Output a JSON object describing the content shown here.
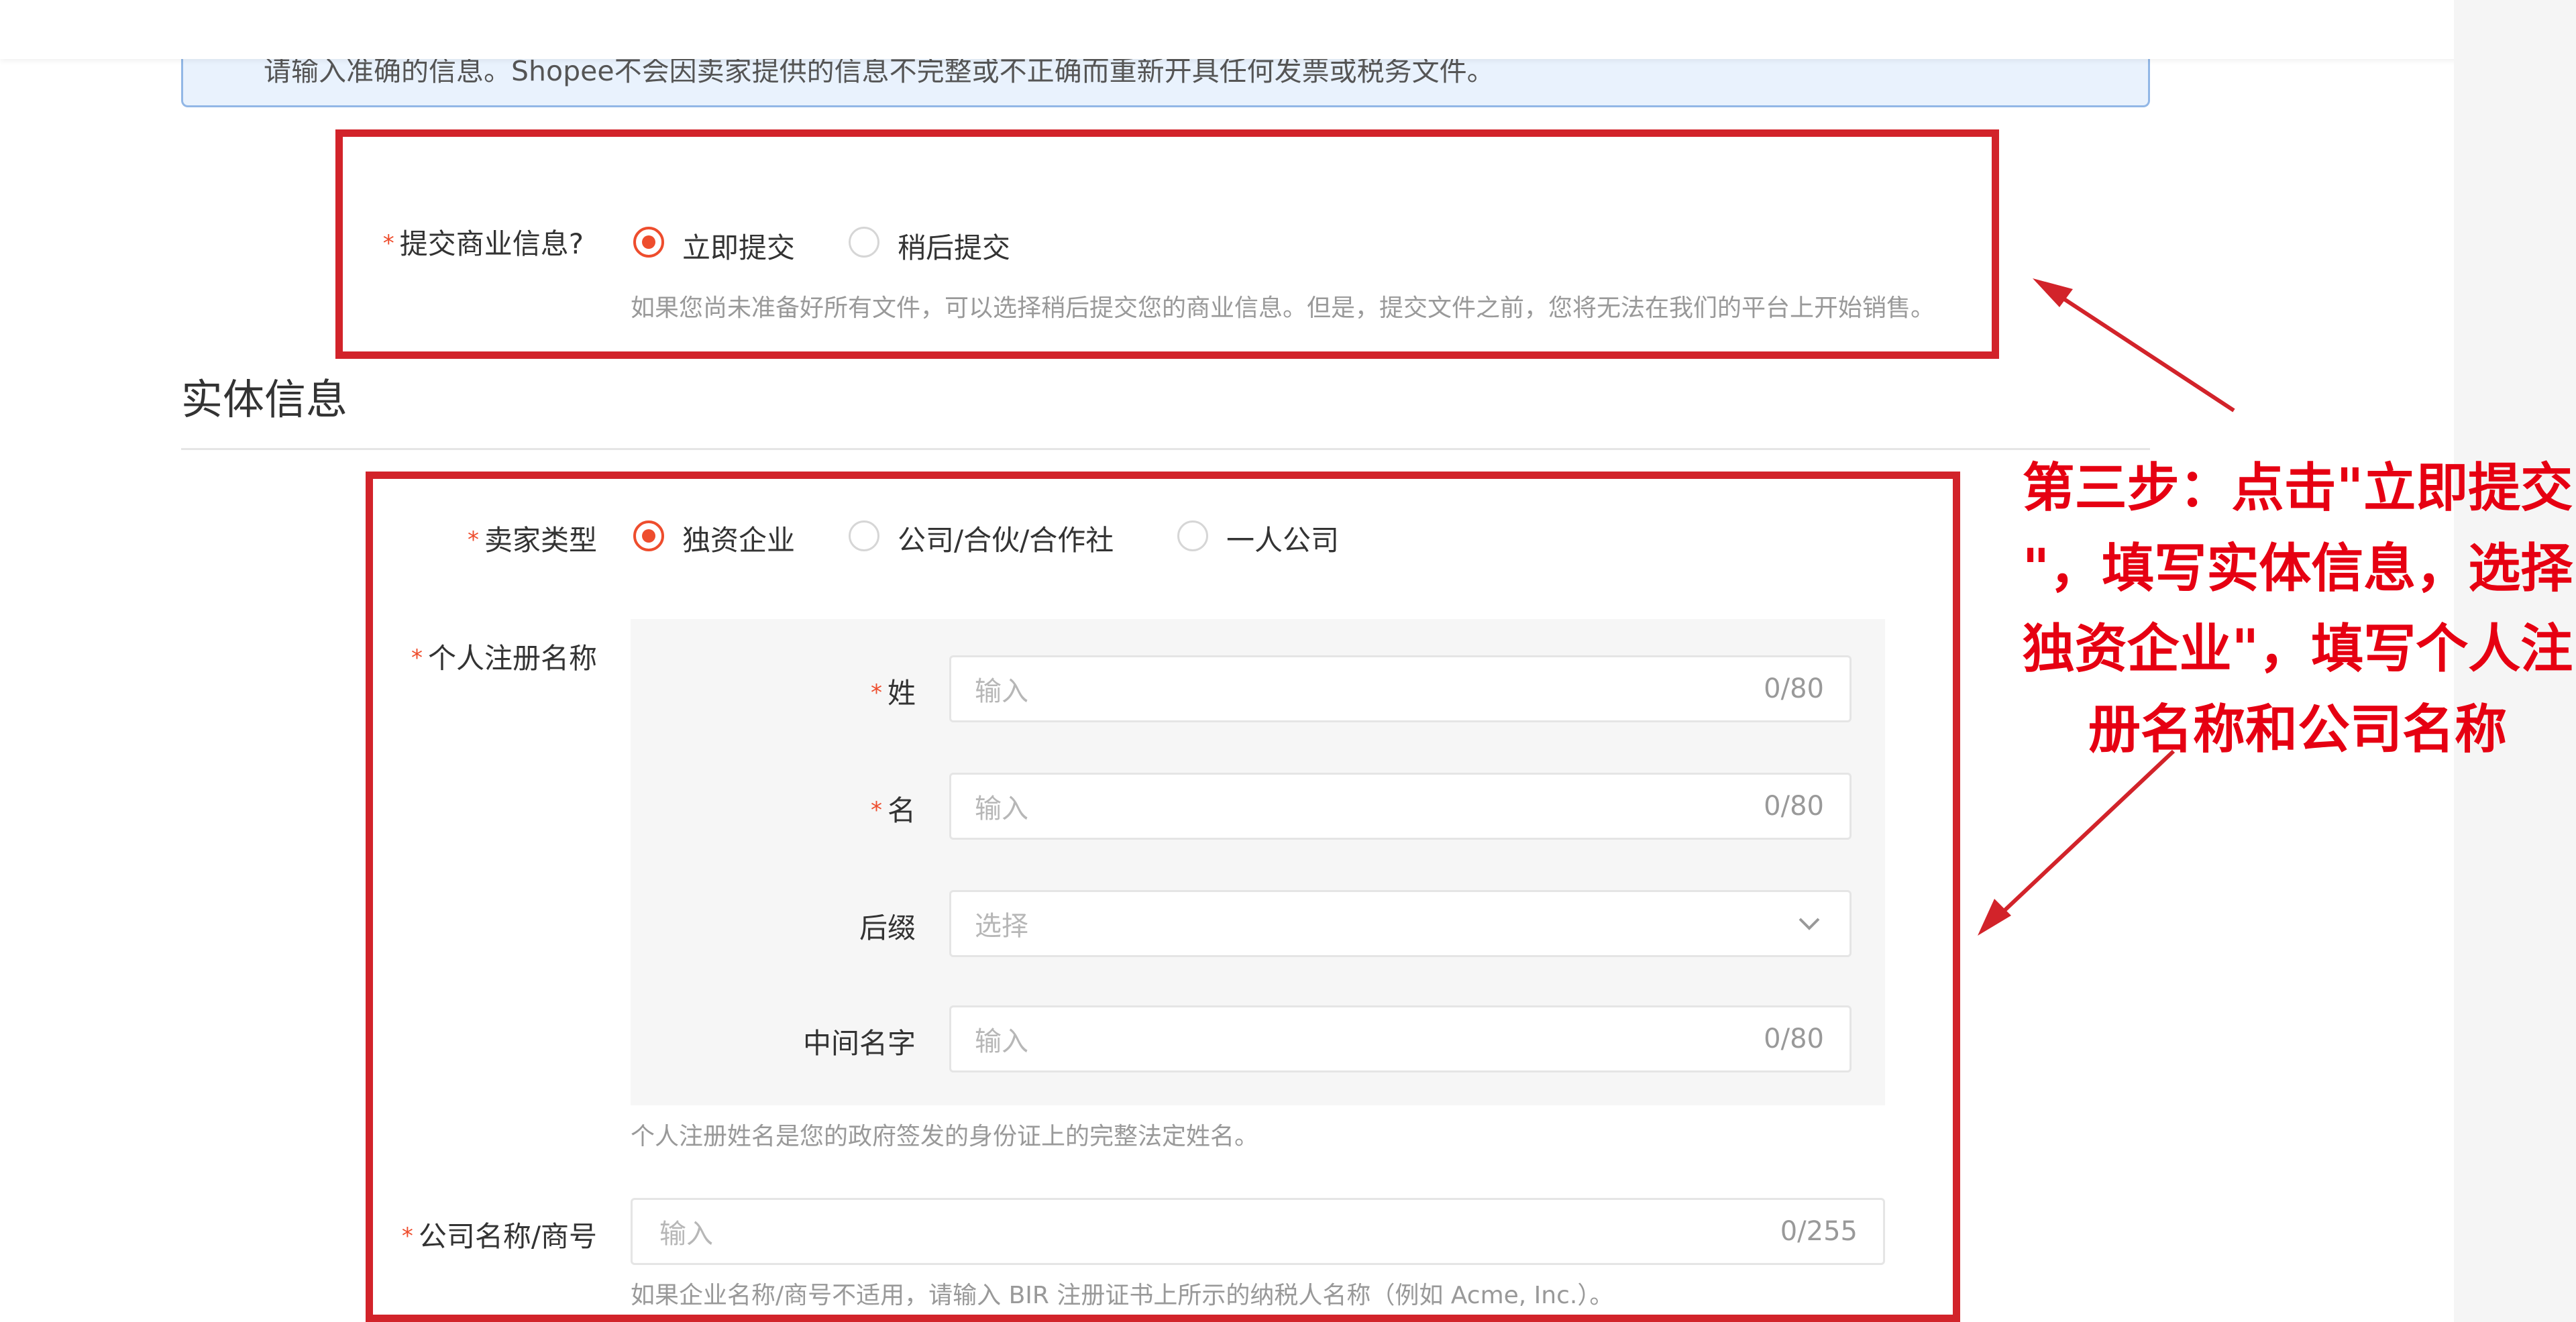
{
  "notice": {
    "text": "请输入准确的信息。Shopee不会因卖家提供的信息不完整或不正确而重新开具任何发票或税务文件。"
  },
  "submit_info": {
    "label": "提交商业信息?",
    "options": [
      "立即提交",
      "稍后提交"
    ],
    "selected": "立即提交",
    "hint": "如果您尚未准备好所有文件，可以选择稍后提交您的商业信息。但是，提交文件之前，您将无法在我们的平台上开始销售。"
  },
  "entity": {
    "title": "实体信息",
    "seller_type": {
      "label": "卖家类型",
      "options": [
        "独资企业",
        "公司/合伙/合作社",
        "一人公司"
      ],
      "selected": "独资企业"
    },
    "registered_name": {
      "label": "个人注册名称",
      "last_name": {
        "label": "姓",
        "placeholder": "输入",
        "counter": "0/80"
      },
      "first_name": {
        "label": "名",
        "placeholder": "输入",
        "counter": "0/80"
      },
      "suffix": {
        "label": "后缀",
        "placeholder": "选择"
      },
      "middle_name": {
        "label": "中间名字",
        "placeholder": "输入",
        "counter": "0/80"
      },
      "hint": "个人注册姓名是您的政府签发的身份证上的完整法定姓名。"
    },
    "company_name": {
      "label": "公司名称/商号",
      "placeholder": "输入",
      "counter": "0/255",
      "hint": "如果企业名称/商号不适用，请输入 BIR 注册证书上所示的纳税人名称（例如 Acme, Inc.）。"
    }
  },
  "annotation": {
    "text": "第三步：点击\"立即提交\n\"，填写实体信息，选择\n独资企业\"，填写个人注\n册名称和公司名称",
    "color": "#e60012"
  },
  "colors": {
    "accent": "#ee4d2d",
    "highlight_box": "#d2232a"
  }
}
